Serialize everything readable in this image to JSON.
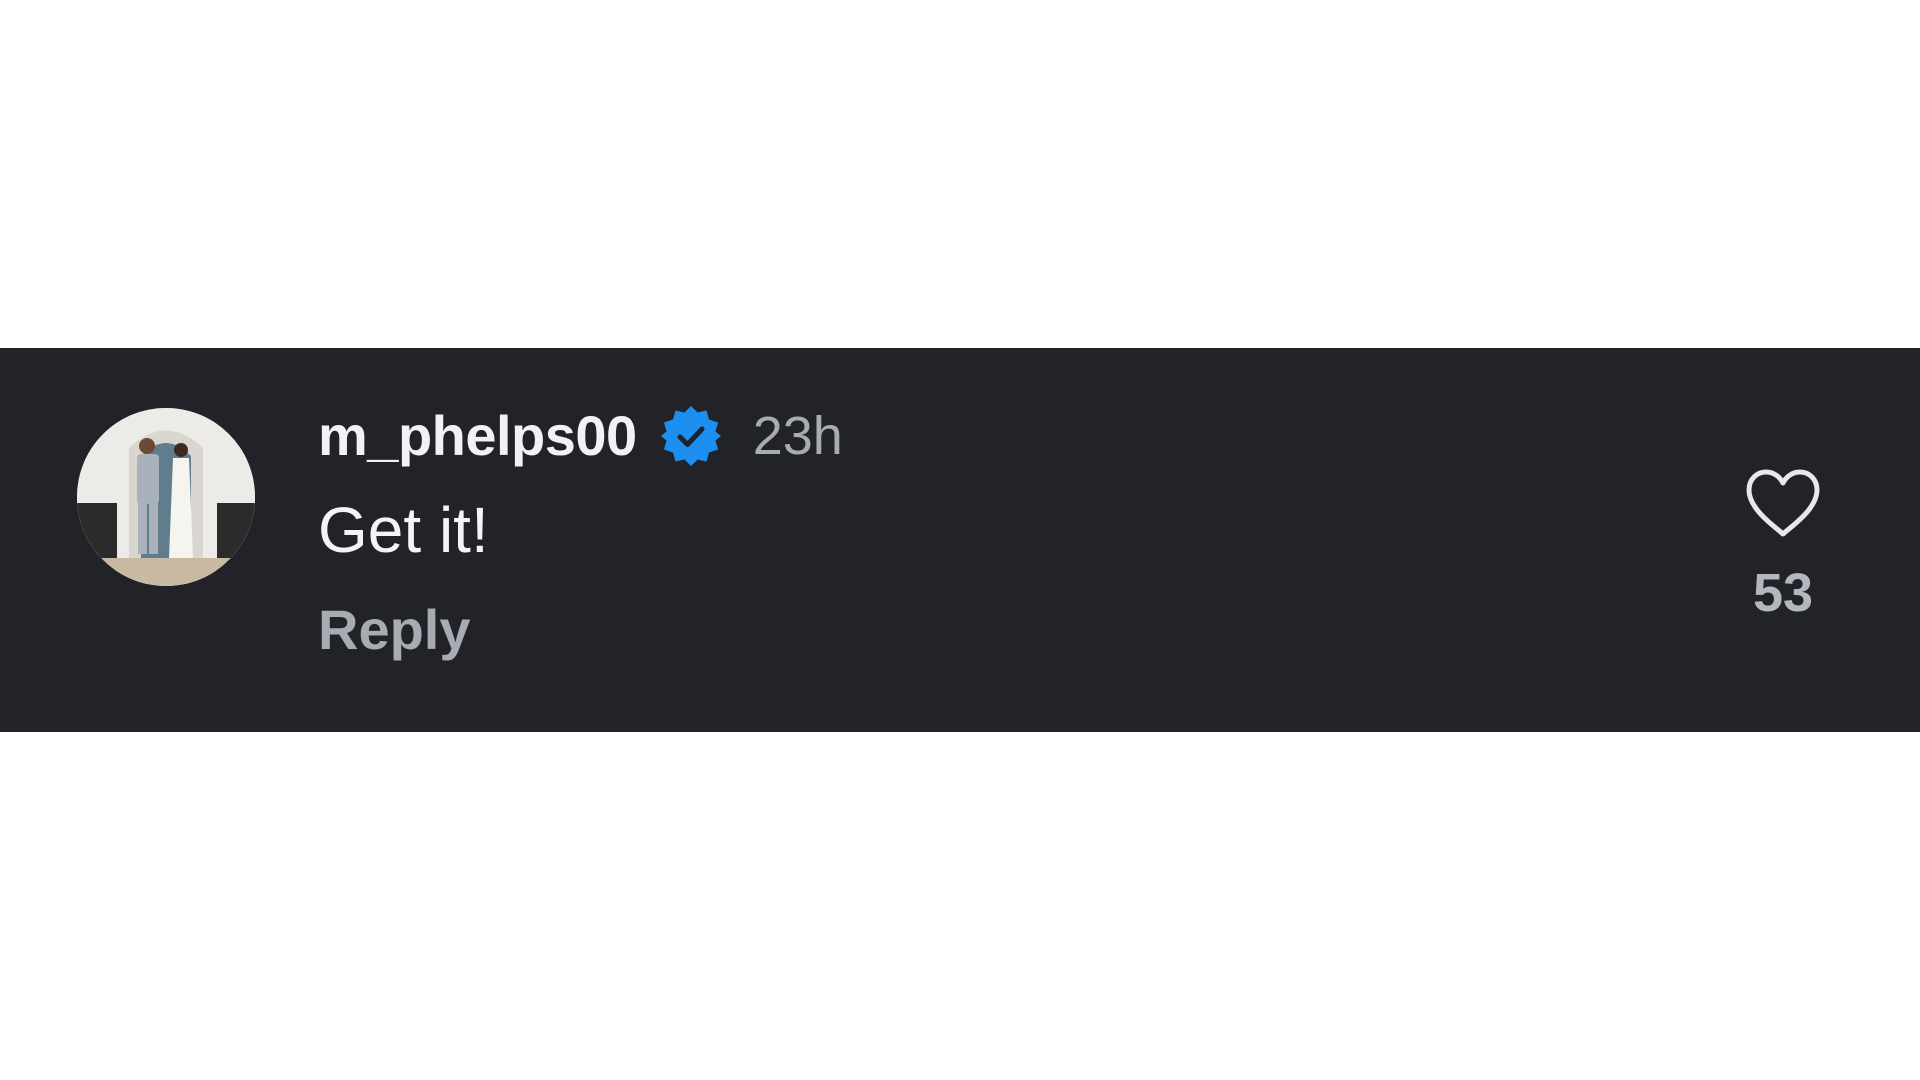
{
  "comment": {
    "username": "m_phelps00",
    "verified_badge_icon": "verified-badge-icon",
    "timestamp": "23h",
    "text": "Get it!",
    "reply_label": "Reply",
    "like_icon": "heart-outline-icon",
    "like_count": "53"
  },
  "colors": {
    "background": "#212328",
    "username": "#f2f2f2",
    "secondary_text": "#a9abb3",
    "verified_blue": "#1d8ff0"
  }
}
